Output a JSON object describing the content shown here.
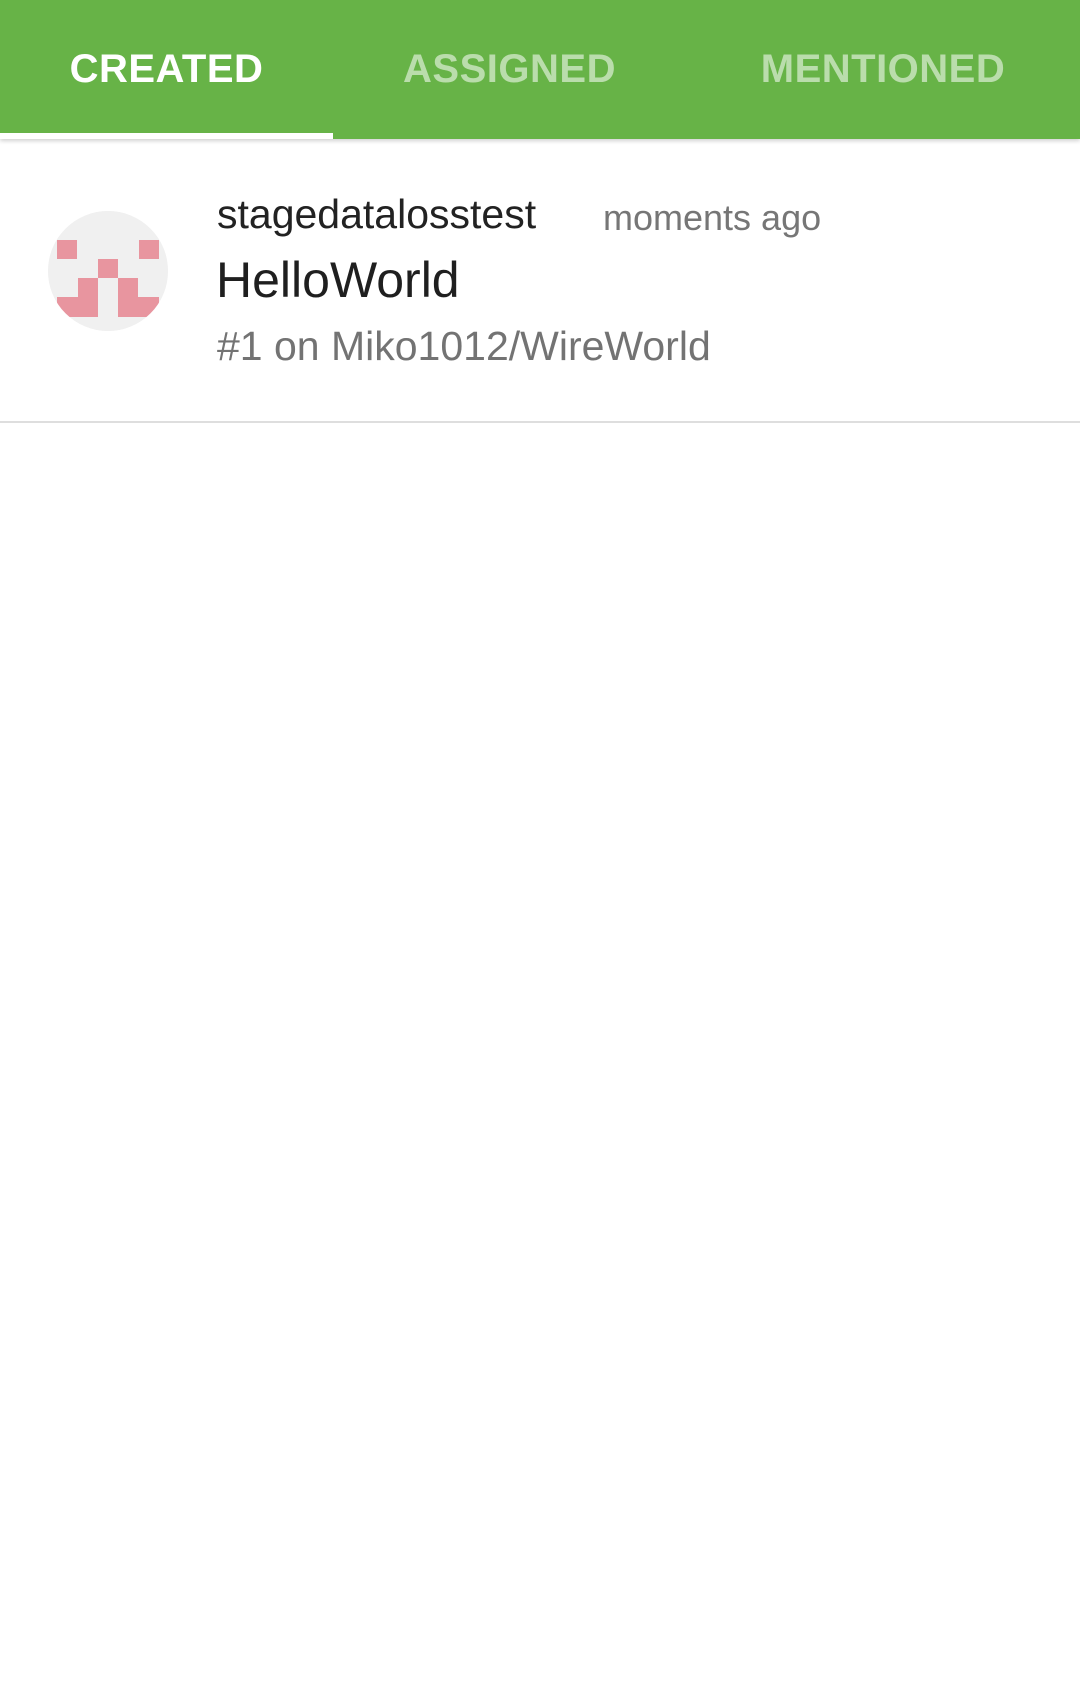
{
  "tabs": [
    {
      "label": "CREATED",
      "active": true
    },
    {
      "label": "ASSIGNED",
      "active": false
    },
    {
      "label": "MENTIONED",
      "active": false
    }
  ],
  "issues": [
    {
      "author": "stagedatalosstest",
      "time": "moments ago",
      "title": "HelloWorld",
      "repo_line": "#1 on Miko1012/WireWorld"
    }
  ],
  "colors": {
    "tabbar": "#67b347",
    "avatar_pattern": "#e8959f",
    "avatar_background": "#f0f0f0"
  },
  "icons": {
    "avatar": "identicon-avatar"
  }
}
